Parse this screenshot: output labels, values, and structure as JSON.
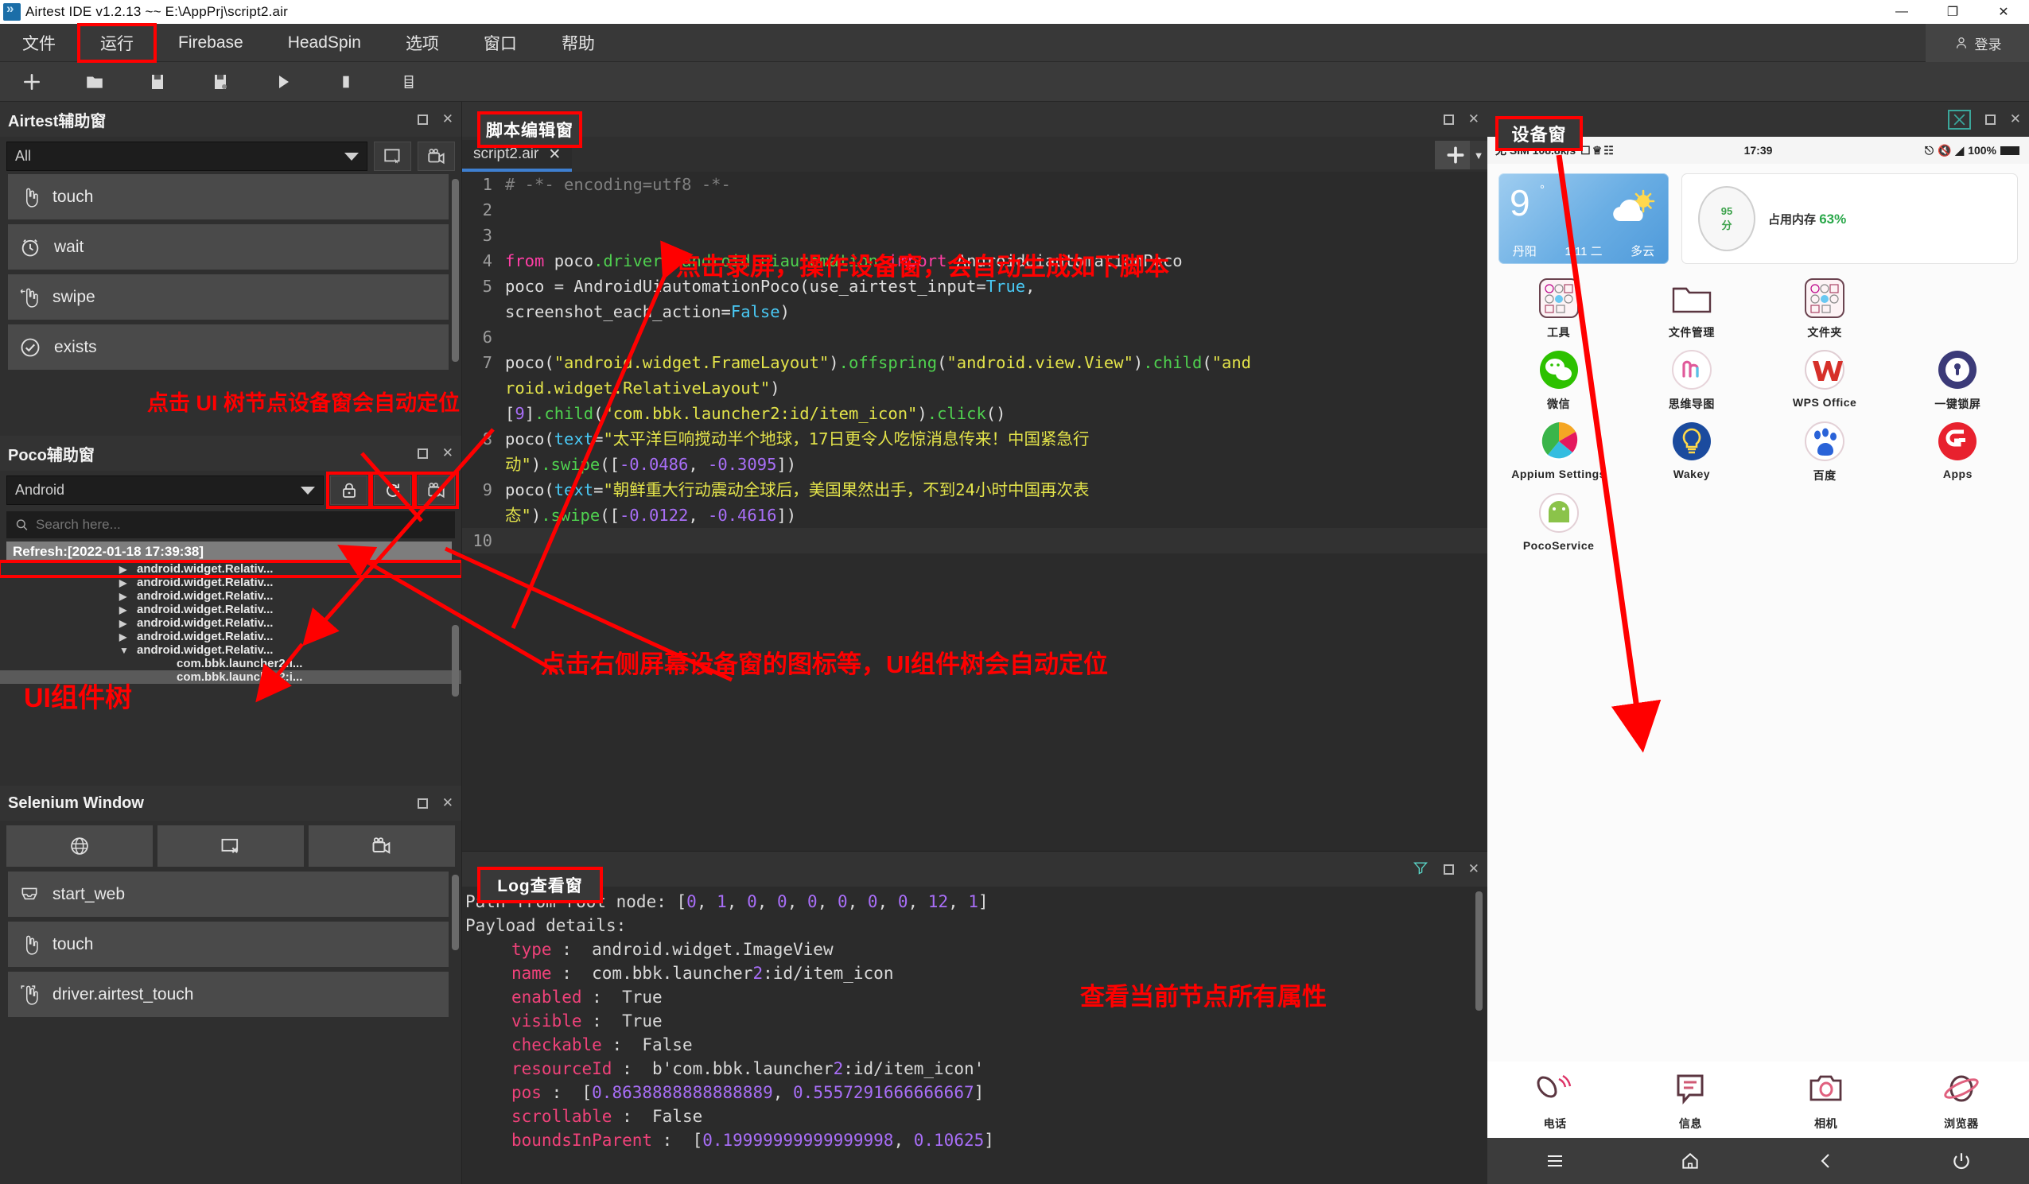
{
  "titlebar": {
    "title": "Airtest IDE v1.2.13 ~~ E:\\AppPrj\\script2.air",
    "minimize": "—",
    "maximize": "❐",
    "close": "✕"
  },
  "menubar": {
    "items": [
      {
        "label": "文件",
        "boxed": false
      },
      {
        "label": "运行",
        "boxed": true
      },
      {
        "label": "Firebase",
        "boxed": false
      },
      {
        "label": "HeadSpin",
        "boxed": false
      },
      {
        "label": "选项",
        "boxed": false
      },
      {
        "label": "窗口",
        "boxed": false
      },
      {
        "label": "帮助",
        "boxed": false
      }
    ],
    "login_label": "登录"
  },
  "toolbar": {
    "buttons": [
      {
        "name": "new-file-icon"
      },
      {
        "name": "open-folder-icon"
      },
      {
        "name": "save-icon"
      },
      {
        "name": "save-as-icon"
      },
      {
        "name": "run-icon"
      },
      {
        "name": "stop-icon"
      },
      {
        "name": "log-view-icon"
      }
    ]
  },
  "airtest_panel": {
    "title": "Airtest辅助窗",
    "filter_value": "All",
    "buttons": [
      {
        "name": "screenshot-icon"
      },
      {
        "name": "record-icon"
      }
    ],
    "actions": [
      {
        "label": "touch",
        "icon": "hand-touch-icon"
      },
      {
        "label": "wait",
        "icon": "clock-icon"
      },
      {
        "label": "swipe",
        "icon": "swipe-icon"
      },
      {
        "label": "exists",
        "icon": "check-circle-icon"
      }
    ]
  },
  "poco_panel": {
    "title": "Poco辅助窗",
    "platform_value": "Android",
    "buttons": [
      {
        "name": "lock-icon",
        "boxed": true
      },
      {
        "name": "refresh-icon",
        "boxed": true
      },
      {
        "name": "record-icon",
        "boxed": true
      }
    ],
    "search_placeholder": "Search here...",
    "refresh_label": "Refresh:[2022-01-18 17:39:38]",
    "tree": [
      {
        "label": "android.widget.Relativ...",
        "tri": "▶",
        "boxed": true,
        "leaf": false,
        "selected": false
      },
      {
        "label": "android.widget.Relativ...",
        "tri": "▶",
        "boxed": false,
        "leaf": false,
        "selected": false
      },
      {
        "label": "android.widget.Relativ...",
        "tri": "▶",
        "boxed": false,
        "leaf": false,
        "selected": false
      },
      {
        "label": "android.widget.Relativ...",
        "tri": "▶",
        "boxed": false,
        "leaf": false,
        "selected": false
      },
      {
        "label": "android.widget.Relativ...",
        "tri": "▶",
        "boxed": false,
        "leaf": false,
        "selected": false
      },
      {
        "label": "android.widget.Relativ...",
        "tri": "▶",
        "boxed": false,
        "leaf": false,
        "selected": false
      },
      {
        "label": "android.widget.Relativ...",
        "tri": "▼",
        "boxed": false,
        "leaf": false,
        "selected": false
      },
      {
        "label": "com.bbk.launcher2:i...",
        "tri": "",
        "boxed": false,
        "leaf": true,
        "selected": false
      },
      {
        "label": "com.bbk.launcher2:i...",
        "tri": "",
        "boxed": false,
        "leaf": true,
        "selected": true
      }
    ]
  },
  "selenium_panel": {
    "title": "Selenium Window",
    "buttons": [
      {
        "name": "globe-icon"
      },
      {
        "name": "window-close-icon"
      },
      {
        "name": "record-icon"
      }
    ],
    "actions": [
      {
        "label": "start_web",
        "icon": "web-inbox-icon"
      },
      {
        "label": "touch",
        "icon": "hand-touch-icon"
      },
      {
        "label": "driver.airtest_touch",
        "icon": "target-touch-icon"
      }
    ]
  },
  "editor": {
    "tab_label": "script2.air",
    "tab_close": "✕",
    "add_button": "+",
    "add_caret": "▼",
    "lines": [
      {
        "no": "1",
        "tokens": [
          {
            "t": "# -*- encoding=utf8 -*-",
            "c": "k-com"
          }
        ]
      },
      {
        "no": "2",
        "tokens": []
      },
      {
        "no": "3",
        "tokens": []
      },
      {
        "no": "4",
        "tokens": [
          {
            "t": "from ",
            "c": "k-kw"
          },
          {
            "t": "poco",
            "c": "k-pl"
          },
          {
            "t": ".drivers.android.uiautomation",
            "c": "k-fn"
          },
          {
            "t": " import ",
            "c": "k-kw"
          },
          {
            "t": "AndroidUiautomationPoco",
            "c": "k-pl"
          }
        ]
      },
      {
        "no": "5",
        "tokens": [
          {
            "t": "poco = AndroidUiautomationPoco(use_airtest_input=",
            "c": "k-pl"
          },
          {
            "t": "True",
            "c": "k-bool"
          },
          {
            "t": ",",
            "c": "k-pl"
          }
        ]
      },
      {
        "no": "",
        "tokens": [
          {
            "t": "screenshot_each_action=",
            "c": "k-pl"
          },
          {
            "t": "False",
            "c": "k-bool"
          },
          {
            "t": ")",
            "c": "k-pl"
          }
        ]
      },
      {
        "no": "6",
        "tokens": []
      },
      {
        "no": "7",
        "tokens": [
          {
            "t": "poco(",
            "c": "k-pl"
          },
          {
            "t": "\"android.widget.FrameLayout\"",
            "c": "k-str"
          },
          {
            "t": ")",
            "c": "k-pl"
          },
          {
            "t": ".offspring",
            "c": "k-fn"
          },
          {
            "t": "(",
            "c": "k-pl"
          },
          {
            "t": "\"android.view.View\"",
            "c": "k-str"
          },
          {
            "t": ")",
            "c": "k-pl"
          },
          {
            "t": ".child",
            "c": "k-fn"
          },
          {
            "t": "(",
            "c": "k-pl"
          },
          {
            "t": "\"and",
            "c": "k-str"
          }
        ]
      },
      {
        "no": "",
        "tokens": [
          {
            "t": "roid.widget.RelativeLayout\"",
            "c": "k-str"
          },
          {
            "t": ")",
            "c": "k-pl"
          }
        ]
      },
      {
        "no": "",
        "tokens": [
          {
            "t": "[",
            "c": "k-pl"
          },
          {
            "t": "9",
            "c": "k-num"
          },
          {
            "t": "]",
            "c": "k-pl"
          },
          {
            "t": ".child",
            "c": "k-fn"
          },
          {
            "t": "(",
            "c": "k-pl"
          },
          {
            "t": "\"com.bbk.launcher2:id/item_icon\"",
            "c": "k-str"
          },
          {
            "t": ")",
            "c": "k-pl"
          },
          {
            "t": ".click",
            "c": "k-fn"
          },
          {
            "t": "()",
            "c": "k-pl"
          }
        ]
      },
      {
        "no": "8",
        "tokens": [
          {
            "t": "poco(",
            "c": "k-pl"
          },
          {
            "t": "text",
            "c": "k-bool"
          },
          {
            "t": "=",
            "c": "k-pl"
          },
          {
            "t": "\"太平洋巨响搅动半个地球，17日更令人吃惊消息传来！中国紧急行",
            "c": "k-str"
          }
        ]
      },
      {
        "no": "",
        "tokens": [
          {
            "t": "动\"",
            "c": "k-str"
          },
          {
            "t": ")",
            "c": "k-pl"
          },
          {
            "t": ".swipe",
            "c": "k-fn"
          },
          {
            "t": "([",
            "c": "k-pl"
          },
          {
            "t": "-0.0486",
            "c": "k-num"
          },
          {
            "t": ", ",
            "c": "k-pl"
          },
          {
            "t": "-0.3095",
            "c": "k-num"
          },
          {
            "t": "])",
            "c": "k-pl"
          }
        ]
      },
      {
        "no": "9",
        "tokens": [
          {
            "t": "poco(",
            "c": "k-pl"
          },
          {
            "t": "text",
            "c": "k-bool"
          },
          {
            "t": "=",
            "c": "k-pl"
          },
          {
            "t": "\"朝鲜重大行动震动全球后，美国果然出手，不到24小时中国再次表",
            "c": "k-str"
          }
        ]
      },
      {
        "no": "",
        "tokens": [
          {
            "t": "态\"",
            "c": "k-str"
          },
          {
            "t": ")",
            "c": "k-pl"
          },
          {
            "t": ".swipe",
            "c": "k-fn"
          },
          {
            "t": "([",
            "c": "k-pl"
          },
          {
            "t": "-0.0122",
            "c": "k-num"
          },
          {
            "t": ", ",
            "c": "k-pl"
          },
          {
            "t": "-0.4616",
            "c": "k-num"
          },
          {
            "t": "])",
            "c": "k-pl"
          }
        ]
      },
      {
        "no": "10",
        "tokens": [],
        "current": true
      }
    ]
  },
  "log": {
    "lines": [
      {
        "indent": 0,
        "tokens": [
          {
            "t": "Path from root node: ",
            "c": ""
          },
          {
            "t": "[",
            "c": ""
          },
          {
            "t": "0",
            "c": "log-num"
          },
          {
            "t": ", ",
            "c": ""
          },
          {
            "t": "1",
            "c": "log-num"
          },
          {
            "t": ", ",
            "c": ""
          },
          {
            "t": "0",
            "c": "log-num"
          },
          {
            "t": ", ",
            "c": ""
          },
          {
            "t": "0",
            "c": "log-num"
          },
          {
            "t": ", ",
            "c": ""
          },
          {
            "t": "0",
            "c": "log-num"
          },
          {
            "t": ", ",
            "c": ""
          },
          {
            "t": "0",
            "c": "log-num"
          },
          {
            "t": ", ",
            "c": ""
          },
          {
            "t": "0",
            "c": "log-num"
          },
          {
            "t": ", ",
            "c": ""
          },
          {
            "t": "0",
            "c": "log-num"
          },
          {
            "t": ", ",
            "c": ""
          },
          {
            "t": "12",
            "c": "log-num"
          },
          {
            "t": ", ",
            "c": ""
          },
          {
            "t": "1",
            "c": "log-num"
          },
          {
            "t": "]",
            "c": ""
          }
        ]
      },
      {
        "indent": 0,
        "tokens": [
          {
            "t": "Payload details:",
            "c": ""
          }
        ]
      },
      {
        "indent": 1,
        "tokens": [
          {
            "t": "type",
            "c": "log-key"
          },
          {
            "t": " :  android.widget.ImageView",
            "c": ""
          }
        ]
      },
      {
        "indent": 1,
        "tokens": [
          {
            "t": "name",
            "c": "log-key"
          },
          {
            "t": " :  com.bbk.launcher",
            "c": ""
          },
          {
            "t": "2",
            "c": "log-num"
          },
          {
            "t": ":id/item_icon",
            "c": ""
          }
        ]
      },
      {
        "indent": 1,
        "tokens": [
          {
            "t": "enabled",
            "c": "log-key"
          },
          {
            "t": " :  True",
            "c": ""
          }
        ]
      },
      {
        "indent": 1,
        "tokens": [
          {
            "t": "visible",
            "c": "log-key"
          },
          {
            "t": " :  True",
            "c": ""
          }
        ]
      },
      {
        "indent": 1,
        "tokens": [
          {
            "t": "checkable",
            "c": "log-key"
          },
          {
            "t": " :  False",
            "c": ""
          }
        ]
      },
      {
        "indent": 1,
        "tokens": [
          {
            "t": "resourceId",
            "c": "log-key"
          },
          {
            "t": " :  b'com.bbk.launcher",
            "c": ""
          },
          {
            "t": "2",
            "c": "log-num"
          },
          {
            "t": ":id/item_icon'",
            "c": ""
          }
        ]
      },
      {
        "indent": 1,
        "tokens": [
          {
            "t": "pos",
            "c": "log-key"
          },
          {
            "t": " :  [",
            "c": ""
          },
          {
            "t": "0.8638888888888889",
            "c": "log-num"
          },
          {
            "t": ", ",
            "c": ""
          },
          {
            "t": "0.5557291666666667",
            "c": "log-num"
          },
          {
            "t": "]",
            "c": ""
          }
        ]
      },
      {
        "indent": 1,
        "tokens": [
          {
            "t": "scrollable",
            "c": "log-key"
          },
          {
            "t": " :  False",
            "c": ""
          }
        ]
      },
      {
        "indent": 1,
        "tokens": [
          {
            "t": "boundsInParent",
            "c": "log-key"
          },
          {
            "t": " :  [",
            "c": ""
          },
          {
            "t": "0.19999999999999998",
            "c": "log-num"
          },
          {
            "t": ", ",
            "c": ""
          },
          {
            "t": "0.10625",
            "c": "log-num"
          },
          {
            "t": "]",
            "c": ""
          }
        ]
      }
    ]
  },
  "device": {
    "title": "设备窗",
    "statusbar": {
      "left": "无 SIM  108.8k/s",
      "time": "17:39",
      "battery": "100%"
    },
    "weather": {
      "temp": "9",
      "deg": "°",
      "city": "丹阳",
      "date": "1/11 二",
      "cond": "多云"
    },
    "health": {
      "score": "95",
      "score_unit": "分",
      "label": "占用内存",
      "value": "63%"
    },
    "apps": [
      {
        "label": "工具",
        "icon": "folder-group-icon"
      },
      {
        "label": "文件管理",
        "icon": "file-manager-icon"
      },
      {
        "label": "文件夹",
        "icon": "folder-group-icon"
      },
      {
        "label": "",
        "icon": ""
      },
      {
        "label": "微信",
        "icon": "wechat-icon"
      },
      {
        "label": "思维导图",
        "icon": "mindmap-icon"
      },
      {
        "label": "WPS Office",
        "icon": "wps-icon"
      },
      {
        "label": "一键锁屏",
        "icon": "lockscreen-icon"
      },
      {
        "label": "Appium Settings",
        "icon": "appium-icon"
      },
      {
        "label": "Wakey",
        "icon": "wakey-icon"
      },
      {
        "label": "百度",
        "icon": "baidu-icon"
      },
      {
        "label": "Apps",
        "icon": "apps-icon"
      },
      {
        "label": "PocoService",
        "icon": "android-icon"
      }
    ],
    "dock": [
      {
        "label": "电话",
        "icon": "phone-icon"
      },
      {
        "label": "信息",
        "icon": "message-icon"
      },
      {
        "label": "相机",
        "icon": "camera-icon"
      },
      {
        "label": "浏览器",
        "icon": "browser-icon"
      }
    ],
    "navbar": [
      {
        "name": "menu-icon"
      },
      {
        "name": "home-icon"
      },
      {
        "name": "back-icon"
      },
      {
        "name": "power-icon"
      }
    ]
  },
  "annotations": {
    "script_editor_label": "脚本编辑窗",
    "device_label": "设备窗",
    "log_label": "Log查看窗",
    "record_hint": "点击录屏，操作设备窗，会自动生成如下脚本",
    "tree_click_hint": "点击 UI 树节点设备窗会自动定位",
    "screen_click_hint": "点击右侧屏幕设备窗的图标等，UI组件树会自动定位",
    "ui_tree_label": "UI组件树",
    "log_hint": "查看当前节点所有属性"
  }
}
